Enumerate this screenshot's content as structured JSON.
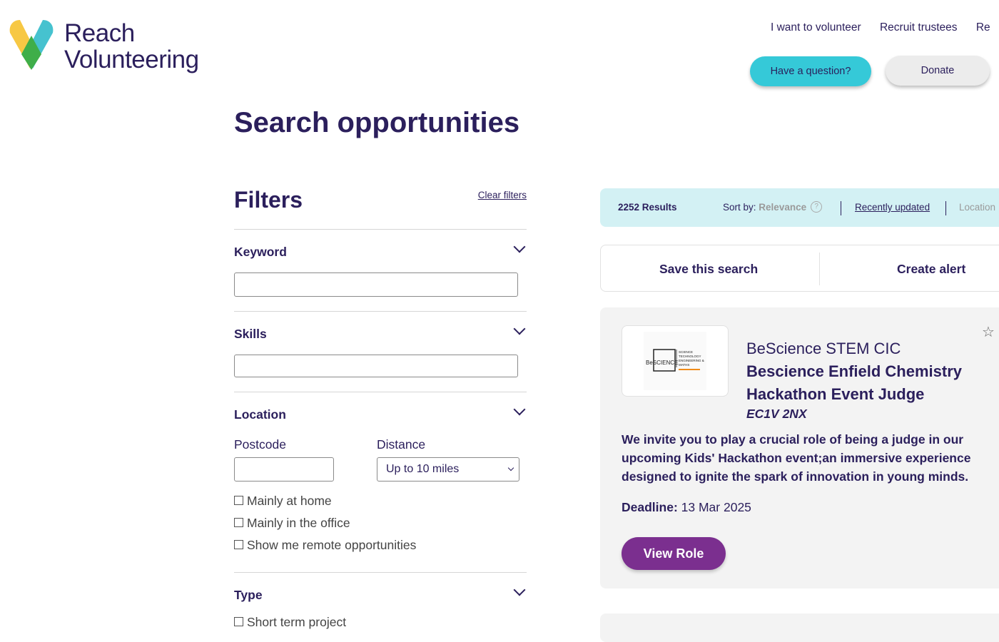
{
  "brand": {
    "line1": "Reach",
    "line2": "Volunteering"
  },
  "nav": {
    "items": [
      "I want to volunteer",
      "Recruit trustees",
      "Re"
    ]
  },
  "header": {
    "question_btn": "Have a question?",
    "donate_btn": "Donate"
  },
  "page": {
    "title": "Search opportunities"
  },
  "filters": {
    "title": "Filters",
    "clear": "Clear filters",
    "keyword": {
      "title": "Keyword",
      "value": ""
    },
    "skills": {
      "title": "Skills",
      "value": ""
    },
    "location": {
      "title": "Location",
      "postcode_label": "Postcode",
      "postcode_value": "",
      "distance_label": "Distance",
      "distance_value": "Up to 10 miles",
      "options": [
        "Mainly at home",
        "Mainly in the office",
        "Show me remote opportunities"
      ]
    },
    "type": {
      "title": "Type",
      "options": [
        "Short term project"
      ]
    }
  },
  "results": {
    "count": "2252 Results",
    "sort_label": "Sort by:",
    "sort_active": "Relevance",
    "sort_recent": "Recently updated",
    "sort_location": "Location"
  },
  "actions": {
    "save": "Save this search",
    "alert": "Create alert"
  },
  "listing": {
    "logo_text": "BeSCIENCE",
    "logo_lines": [
      "SCIENCE",
      "TECHNOLOGY",
      "ENGINEERING &",
      "MATHS"
    ],
    "org": "BeScience STEM CIC",
    "role": "Bescience Enfield Chemistry Hackathon Event Judge",
    "postcode": "EC1V 2NX",
    "description": "We invite you to play a crucial role of being a judge in our upcoming Kids' Hackathon event;an immersive experience designed to ignite the spark of innovation in young minds.",
    "deadline_label": "Deadline:",
    "deadline_value": "13 Mar 2025",
    "cta": "View Role"
  },
  "colors": {
    "navy": "#2b1f5c",
    "teal": "#35c9d8",
    "purple": "#7b2f8f",
    "results_bg": "#d3f1f4"
  }
}
